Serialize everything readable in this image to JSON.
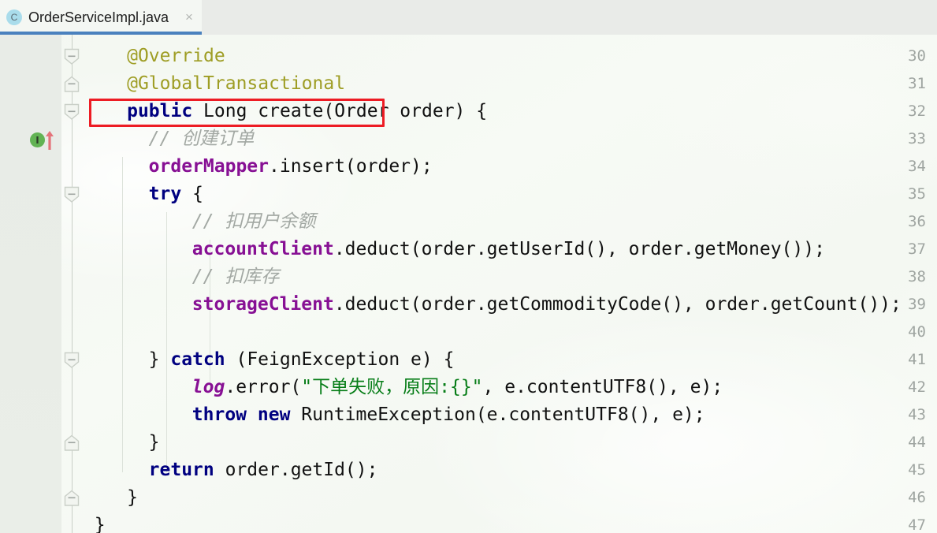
{
  "window": {
    "app": "java-code-editor",
    "background_color": "#F4F7F3"
  },
  "tabbar": {
    "tabs": [
      {
        "label": "OrderServiceImpl.java",
        "icon": "java-class-icon",
        "icon_letter": "C",
        "close_glyph": "×",
        "active": true,
        "active_underline_color": "#4A81BE"
      }
    ]
  },
  "gutter": {
    "line_numbers": [
      "30",
      "31",
      "32",
      "33",
      "34",
      "35",
      "36",
      "37",
      "38",
      "39",
      "40",
      "41",
      "42",
      "43",
      "44",
      "45",
      "46",
      "47"
    ],
    "fold_markers": [
      {
        "line": "30",
        "direction": "down"
      },
      {
        "line": "31",
        "direction": "up"
      },
      {
        "line": "32",
        "direction": "down"
      },
      {
        "line": "35",
        "direction": "down"
      },
      {
        "line": "41",
        "direction": "down"
      },
      {
        "line": "44",
        "direction": "up"
      },
      {
        "line": "46",
        "direction": "up"
      }
    ],
    "markers": [
      {
        "line": "32",
        "icon": "implementing-method-icon",
        "letter": "I",
        "color": "#62B354"
      },
      {
        "line": "32",
        "icon": "override-arrow-icon",
        "color": "#E4737A"
      }
    ]
  },
  "annotation": {
    "shape": "rectangle",
    "color": "#ED1C24",
    "target_line": "31",
    "target_text": "@GlobalTransactional"
  },
  "editor": {
    "language": "java",
    "font": "monospace",
    "colors": {
      "annotation": "#9E9D24",
      "keyword": "#000080",
      "field": "#871094",
      "string": "#067D17",
      "comment": "#A2A8A3",
      "plain": "#111111",
      "line_number": "#9FA5A1",
      "gutter_bg": "#E8ECE7"
    },
    "lines": [
      {
        "n": "30",
        "indent": 4,
        "tokens": [
          {
            "t": "anno",
            "v": "@Override"
          }
        ]
      },
      {
        "n": "31",
        "indent": 4,
        "tokens": [
          {
            "t": "anno",
            "v": "@GlobalTransactional"
          }
        ]
      },
      {
        "n": "32",
        "indent": 4,
        "tokens": [
          {
            "t": "kw",
            "v": "public"
          },
          {
            "t": "plain",
            "v": " Long create(Order order) {"
          }
        ]
      },
      {
        "n": "33",
        "indent": 6,
        "tokens": [
          {
            "t": "cmt",
            "v": "// 创建订单"
          }
        ]
      },
      {
        "n": "34",
        "indent": 6,
        "tokens": [
          {
            "t": "field",
            "v": "orderMapper"
          },
          {
            "t": "plain",
            "v": ".insert(order);"
          }
        ]
      },
      {
        "n": "35",
        "indent": 6,
        "tokens": [
          {
            "t": "kw",
            "v": "try"
          },
          {
            "t": "plain",
            "v": " {"
          }
        ]
      },
      {
        "n": "36",
        "indent": 10,
        "tokens": [
          {
            "t": "cmt",
            "v": "// 扣用户余额"
          }
        ]
      },
      {
        "n": "37",
        "indent": 10,
        "tokens": [
          {
            "t": "field",
            "v": "accountClient"
          },
          {
            "t": "plain",
            "v": ".deduct(order.getUserId(), order.getMoney());"
          }
        ]
      },
      {
        "n": "38",
        "indent": 10,
        "tokens": [
          {
            "t": "cmt",
            "v": "// 扣库存"
          }
        ]
      },
      {
        "n": "39",
        "indent": 10,
        "tokens": [
          {
            "t": "field",
            "v": "storageClient"
          },
          {
            "t": "plain",
            "v": ".deduct(order.getCommodityCode(), order.getCount());"
          }
        ]
      },
      {
        "n": "40",
        "indent": 0,
        "tokens": []
      },
      {
        "n": "41",
        "indent": 6,
        "tokens": [
          {
            "t": "plain",
            "v": "} "
          },
          {
            "t": "kw",
            "v": "catch"
          },
          {
            "t": "plain",
            "v": " (FeignException e) {"
          }
        ]
      },
      {
        "n": "42",
        "indent": 10,
        "tokens": [
          {
            "t": "static",
            "v": "log"
          },
          {
            "t": "plain",
            "v": ".error("
          },
          {
            "t": "str",
            "v": "\"下单失败，原因:{}\""
          },
          {
            "t": "plain",
            "v": ", e.contentUTF8(), e);"
          }
        ]
      },
      {
        "n": "43",
        "indent": 10,
        "tokens": [
          {
            "t": "kw",
            "v": "throw new"
          },
          {
            "t": "plain",
            "v": " RuntimeException(e.contentUTF8(), e);"
          }
        ]
      },
      {
        "n": "44",
        "indent": 6,
        "tokens": [
          {
            "t": "plain",
            "v": "}"
          }
        ]
      },
      {
        "n": "45",
        "indent": 6,
        "tokens": [
          {
            "t": "kw",
            "v": "return"
          },
          {
            "t": "plain",
            "v": " order.getId();"
          }
        ]
      },
      {
        "n": "46",
        "indent": 4,
        "tokens": [
          {
            "t": "plain",
            "v": "}"
          }
        ]
      },
      {
        "n": "47",
        "indent": 1,
        "tokens": [
          {
            "t": "plain",
            "v": "}"
          }
        ]
      }
    ],
    "indent_guides_x": [
      155,
      211,
      266
    ]
  }
}
